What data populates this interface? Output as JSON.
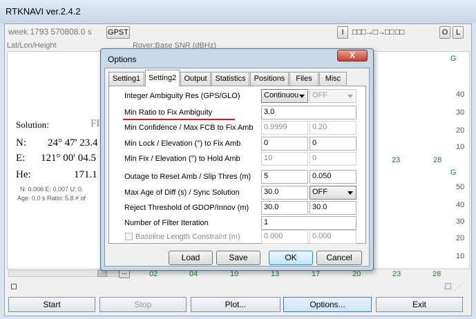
{
  "app": {
    "title": "RTKNAVI ver.2.4.2",
    "time_display": "week 1793 570808.0 s",
    "time_button": "GPST",
    "toolbar_buttons": [
      "I",
      "O",
      "L"
    ],
    "stream_indicator": "□□□→□→□□ □□",
    "solution_mode": "Lat/Lon/Height",
    "plot_mode": "Rover:Base SNR (dBHz)",
    "solution_label": "Solution:",
    "solution_status": "FI",
    "coords": [
      {
        "label": "N:",
        "value": "24° 47' 23.4"
      },
      {
        "label": "E:",
        "value": "121° 00' 04.5"
      },
      {
        "label": "He:",
        "value": "171.1"
      }
    ],
    "std_line": "N: 0.006 E: 0.007 U: 0.",
    "age_line": "Age: 0.0 s Ratio: 5.8 # of",
    "plot_top_g": "G",
    "plot_bottom_g": "G",
    "plot_axis_top": [
      "40",
      "30",
      "20",
      "10"
    ],
    "plot_axis_bottom": [
      "50",
      "40",
      "30",
      "20",
      "10"
    ],
    "plot_mid_labels": [
      "23",
      "28"
    ],
    "prn_labels": [
      "02",
      "04",
      "10",
      "13",
      "17",
      "20",
      "23",
      "28"
    ],
    "scroll_ellipsis": "...",
    "bottom_buttons": {
      "start": "Start",
      "stop": "Stop",
      "plot": "Plot...",
      "options": "Options...",
      "exit": "Exit"
    }
  },
  "dialog": {
    "title": "Options",
    "close_label": "X",
    "tabs": [
      "Setting1",
      "Setting2",
      "Output",
      "Statistics",
      "Positions",
      "Files",
      "Misc"
    ],
    "active_tab": "Setting2",
    "rows": [
      {
        "label": "Integer Ambiguity Res (GPS/GLO)",
        "v1": "Continuou",
        "v2": "OFF"
      },
      {
        "label": "Min Ratio to Fix Ambiguity",
        "v1": "3.0"
      },
      {
        "label": "Min Confidence / Max FCB to Fix Amb",
        "v1": "0.9999",
        "v2": "0.20"
      },
      {
        "label": "Min Lock / Elevation (°) to Fix Amb",
        "v1": "0",
        "v2": "0"
      },
      {
        "label": "Min Fix / Elevation (°) to Hold Amb",
        "v1": "10",
        "v2": "0"
      },
      {
        "label": "Outage to Reset Amb / Slip Thres (m)",
        "v1": "5",
        "v2": "0.050"
      },
      {
        "label": "Max Age of Diff (s) / Sync Solution",
        "v1": "30.0",
        "v2": "OFF"
      },
      {
        "label": "Reject Threshold of GDOP/Innov (m)",
        "v1": "30.0",
        "v2": "30.0"
      },
      {
        "label": "Number of Filter Iteration",
        "v1": "1"
      },
      {
        "label": "Baseline Length Constraint (m)",
        "v1": "0.000",
        "v2": "0.000"
      }
    ],
    "buttons": {
      "load": "Load",
      "save": "Save",
      "ok": "OK",
      "cancel": "Cancel"
    },
    "highlight_color": "#e0141e"
  }
}
